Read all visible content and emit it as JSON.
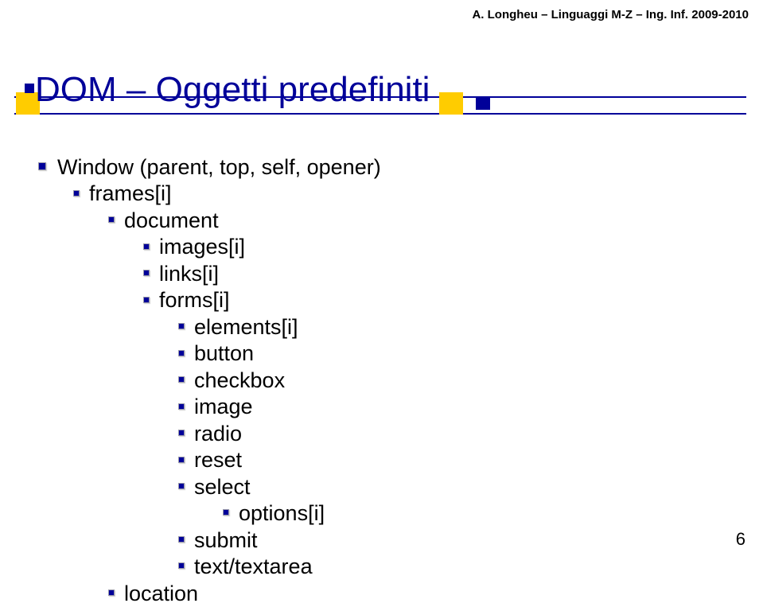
{
  "header": {
    "text": "A. Longheu – Linguaggi M-Z – Ing. Inf. 2009-2010"
  },
  "title": "DOM – Oggetti predefiniti",
  "tree": {
    "window": "Window (parent, top, self, opener)",
    "frames": "frames[i]",
    "document": "document",
    "images": "images[i]",
    "links": "links[i]",
    "forms": "forms[i]",
    "elements": "elements[i]",
    "button": "button",
    "checkbox": "checkbox",
    "image": "image",
    "radio": "radio",
    "reset": "reset",
    "select": "select",
    "options": "options[i]",
    "submit": "submit",
    "textarea": "text/textarea",
    "location": "location"
  },
  "page_number": "6"
}
